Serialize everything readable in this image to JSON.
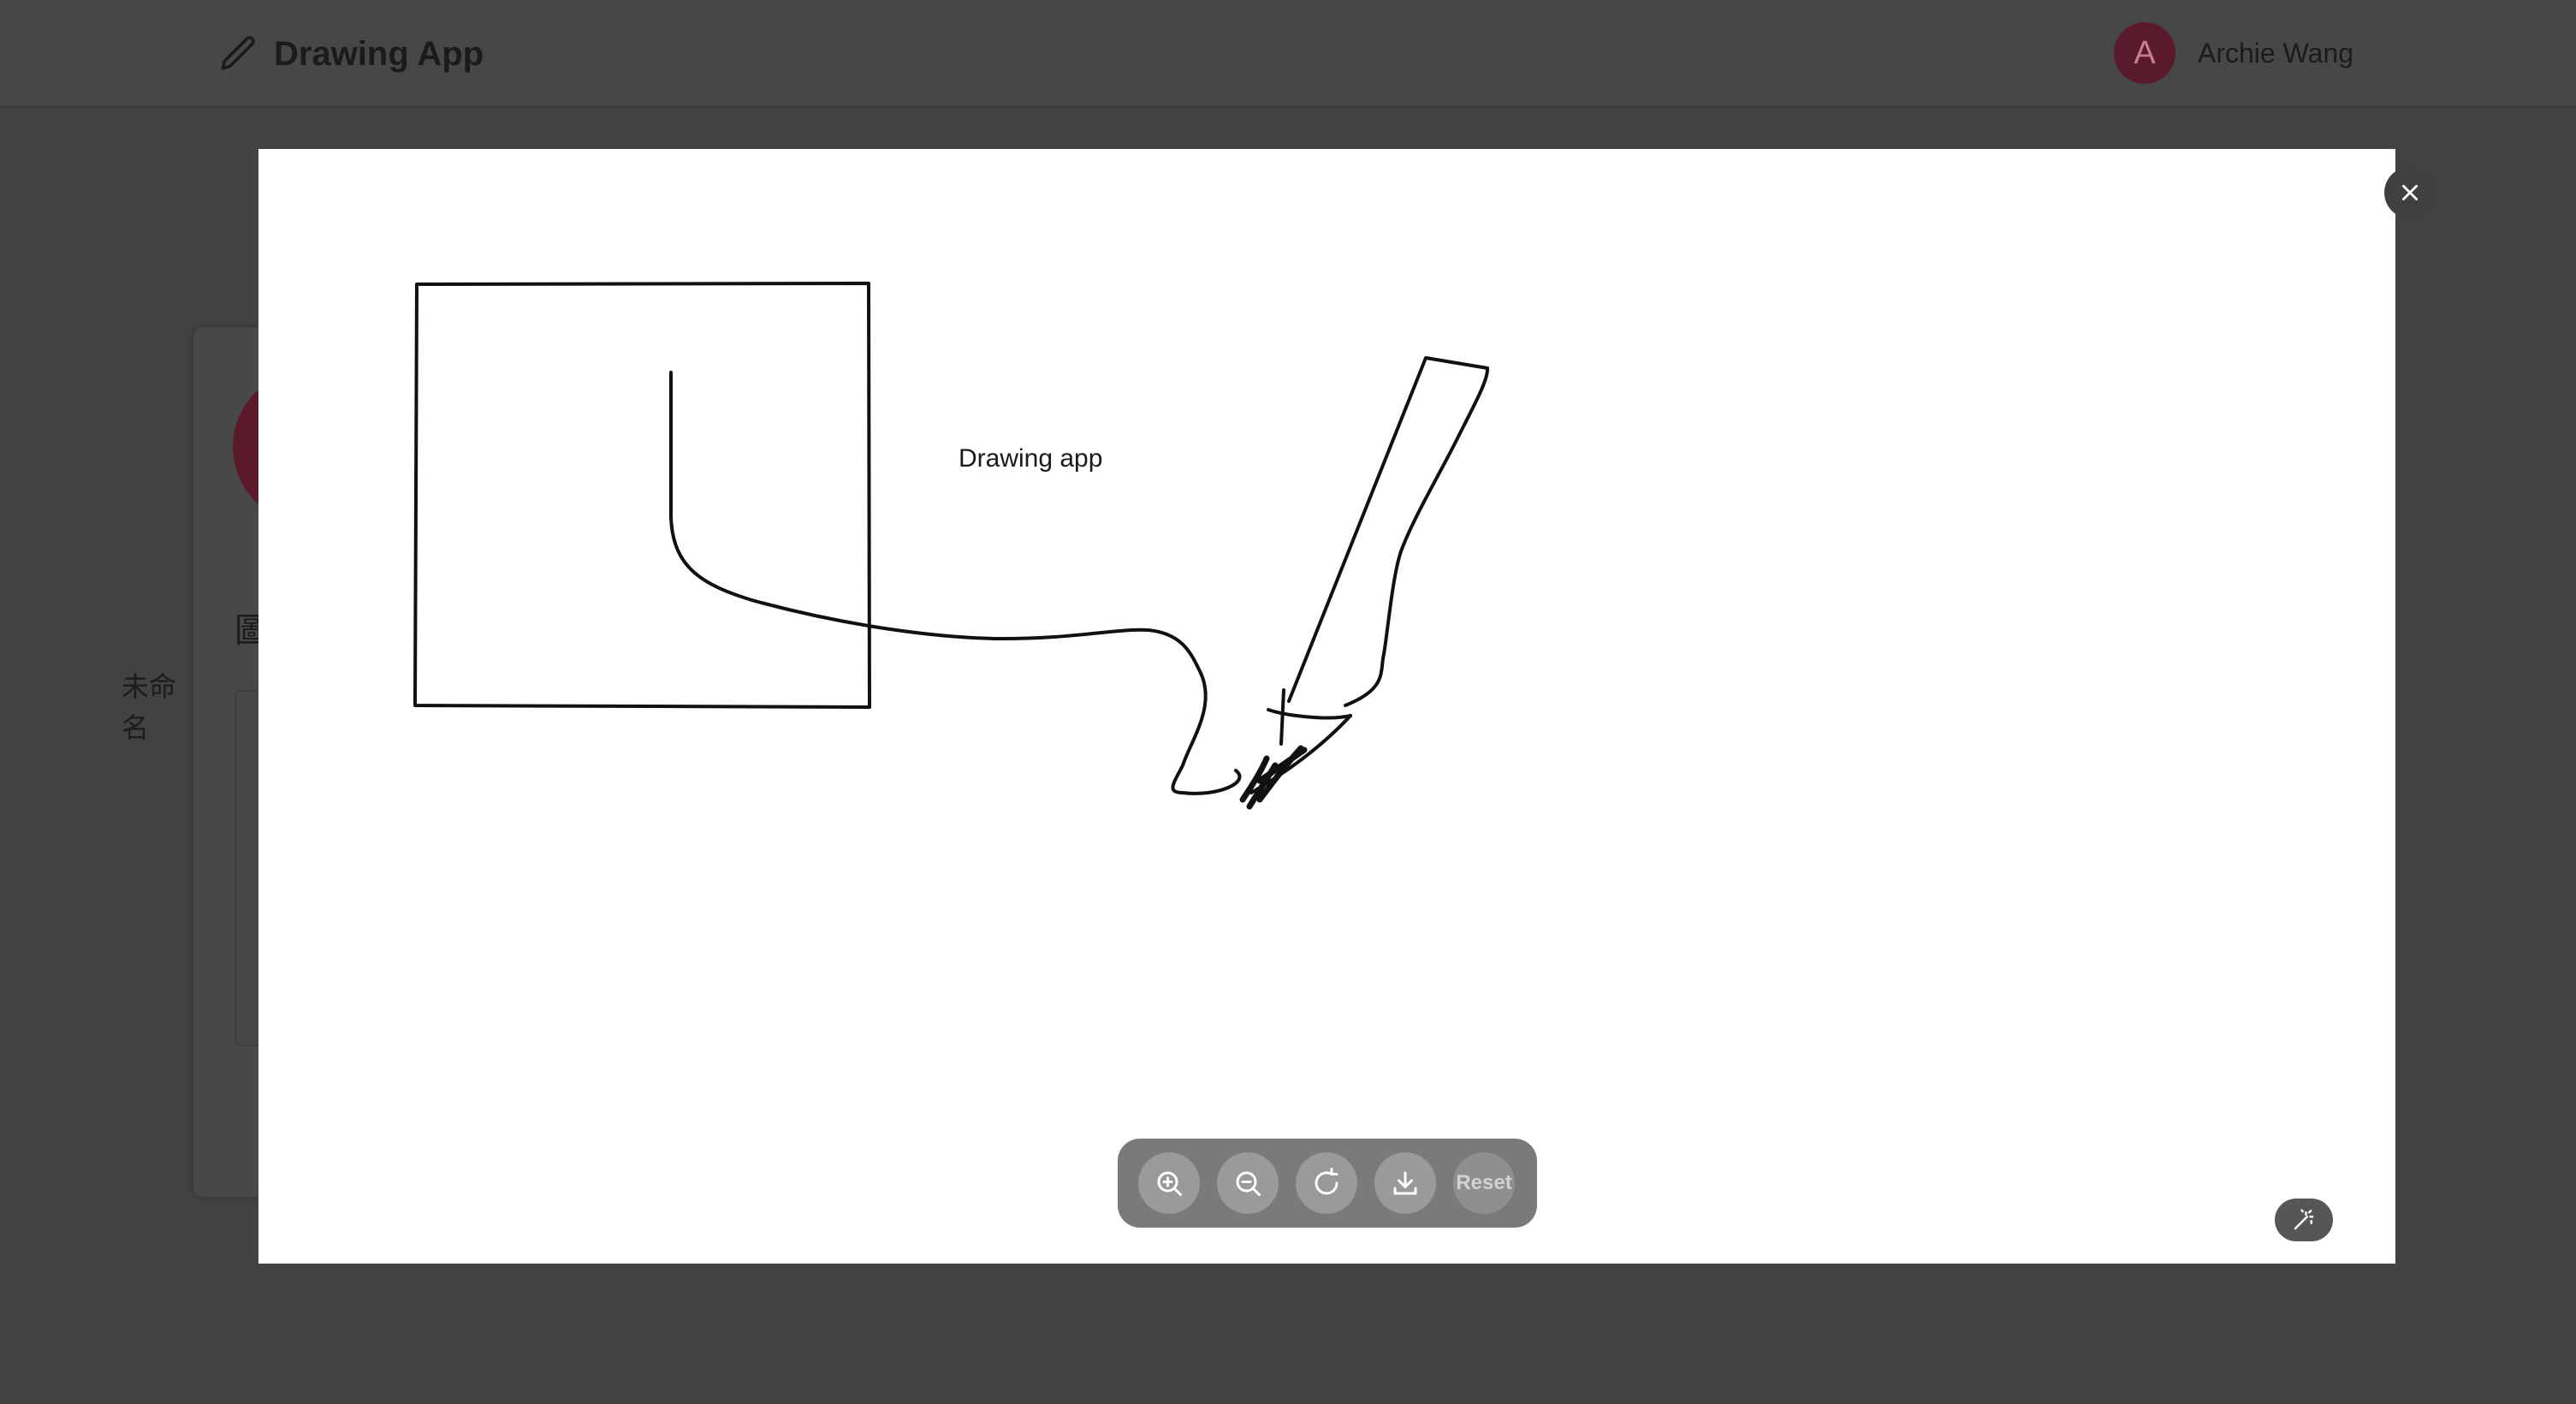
{
  "navbar": {
    "app_title": "Drawing App",
    "brand_icon": "pencil-icon",
    "user_initial": "A",
    "user_name": "Archie Wang"
  },
  "background_page": {
    "heading_fragment": "圖",
    "item_label": "未命名"
  },
  "modal": {
    "canvas_text": "Drawing app",
    "toolbar": {
      "zoom_in_icon": "zoom-in-icon",
      "zoom_out_icon": "zoom-out-icon",
      "rotate_icon": "rotate-icon",
      "download_icon": "download-icon",
      "reset_label": "Reset"
    },
    "close_icon": "close-icon",
    "magic_icon": "magic-wand-icon"
  },
  "colors": {
    "backdrop": "#414242",
    "avatar": "#5a1a2b",
    "toolbar": "#7a7a7a"
  }
}
